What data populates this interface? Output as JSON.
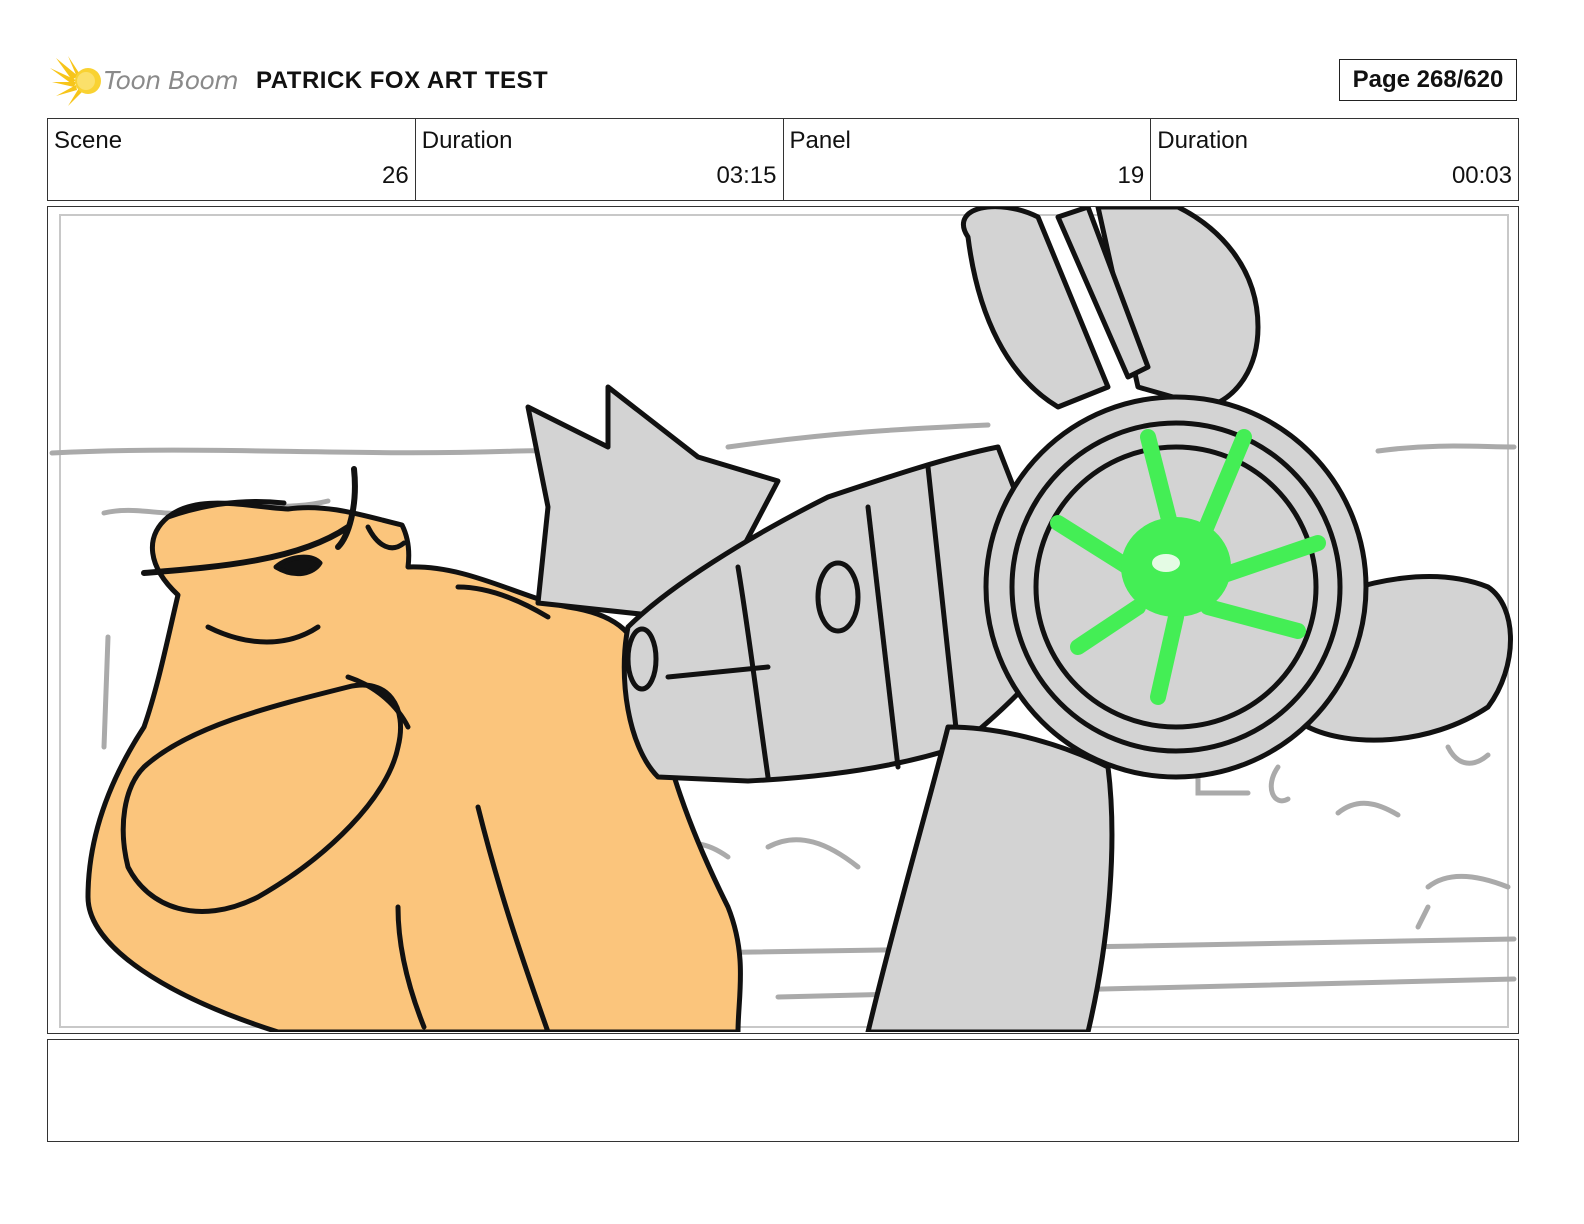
{
  "header": {
    "logo_text": "Toon Boom",
    "logo_icon": "starburst-icon",
    "title": "PATRICK FOX ART TEST",
    "page": "Page 268/620"
  },
  "info": [
    {
      "label": "Scene",
      "value": "26"
    },
    {
      "label": "Duration",
      "value": "03:15"
    },
    {
      "label": "Panel",
      "value": "19"
    },
    {
      "label": "Duration",
      "value": "00:03"
    }
  ],
  "panel": {
    "image": "storyboard-drawing",
    "colors": {
      "skin": "#fbc57c",
      "metal": "#d3d3d3",
      "glow": "#44ee55",
      "sketch": "#aaaaaa"
    }
  },
  "notes": ""
}
